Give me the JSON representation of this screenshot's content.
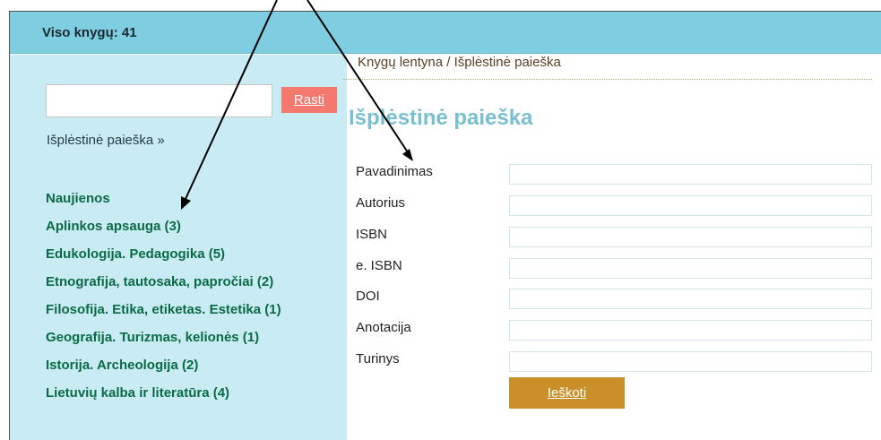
{
  "header": {
    "total_label": "Viso knygų: 41"
  },
  "sidebar": {
    "search_button": "Rasti",
    "advanced_link": "Išplėstinė paieška »",
    "categories": [
      "Naujienos",
      "Aplinkos apsauga (3)",
      "Edukologija. Pedagogika (5)",
      "Etnografija, tautosaka, papročiai (2)",
      "Filosofija. Etika, etiketas. Estetika (1)",
      "Geografija. Turizmas, kelionės (1)",
      "Istorija. Archeologija (2)",
      "Lietuvių kalba ir literatūra (4)"
    ]
  },
  "main": {
    "breadcrumb": "Knygų lentyna / Išplėstinė paieška",
    "title": "Išplėstinė paieška",
    "fields": [
      "Pavadinimas",
      "Autorius",
      "ISBN",
      "e. ISBN",
      "DOI",
      "Anotacija",
      "Turinys"
    ],
    "submit": "Ieškoti"
  },
  "colors": {
    "header_bg": "#7fcde0",
    "sidebar_bg": "#c9ecf4",
    "search_button": "#f5786f",
    "category_text": "#0a6a45",
    "title_text": "#78bfcf",
    "submit_button": "#c9902a"
  },
  "icons": [
    "annotation-arrow",
    "annotation-arrow"
  ]
}
